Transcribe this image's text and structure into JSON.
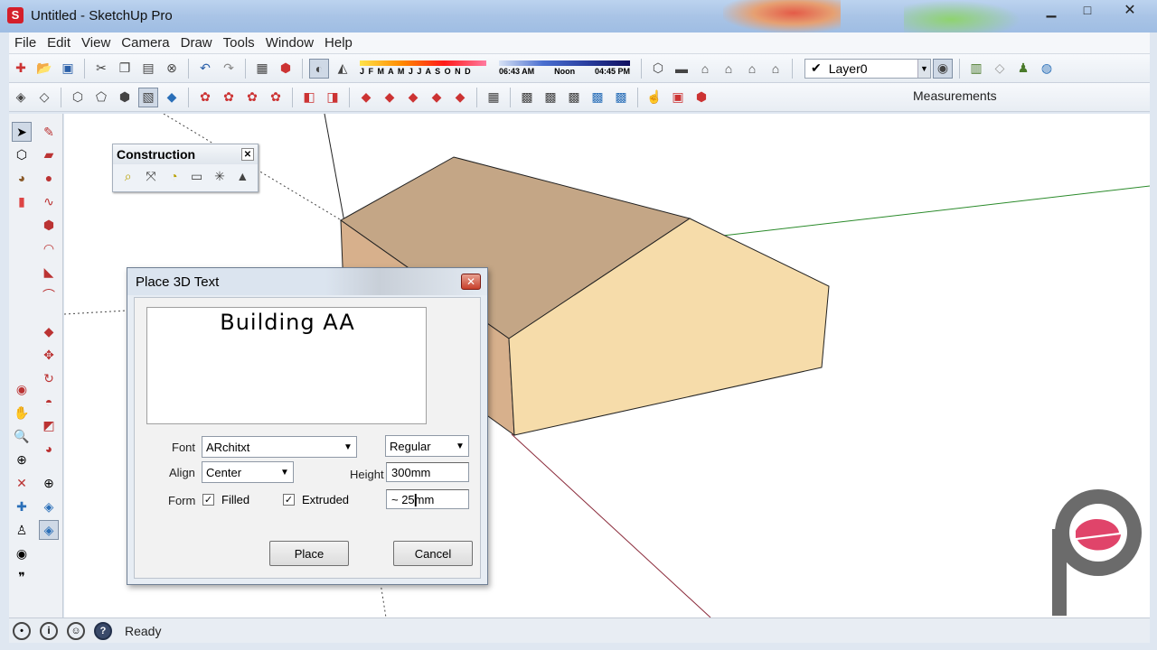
{
  "window": {
    "title": "Untitled - SketchUp Pro",
    "app_icon": "sketchup-logo-icon",
    "controls": [
      "minimize-icon",
      "maximize-icon",
      "close-icon"
    ]
  },
  "menubar": {
    "items": [
      "File",
      "Edit",
      "View",
      "Camera",
      "Draw",
      "Tools",
      "Window",
      "Help"
    ]
  },
  "toolbar1": {
    "shadow": {
      "months": "J F M A M J J A S O N D",
      "time_start": "06:43 AM",
      "time_noon": "Noon",
      "time_end": "04:45 PM"
    },
    "layer": {
      "check": "✔",
      "value": "Layer0"
    }
  },
  "toolbar2": {
    "measurements_label": "Measurements"
  },
  "construction_palette": {
    "title": "Construction",
    "close": "✕"
  },
  "dialog": {
    "title": "Place 3D Text",
    "close": "✕",
    "text_value": "Building AA",
    "font_label": "Font",
    "font_value": "ARchitxt",
    "style_value": "Regular",
    "align_label": "Align",
    "align_value": "Center",
    "height_label": "Height",
    "height_value": "300mm",
    "form_label": "Form",
    "filled_label": "Filled",
    "filled_checked": true,
    "extruded_label": "Extruded",
    "extruded_checked": true,
    "extrude_value": "~ 25mm",
    "place_button": "Place",
    "cancel_button": "Cancel",
    "check_mark": "✓"
  },
  "statusbar": {
    "status_text": "Ready",
    "help_icon_label": "?",
    "info_icon_label": "i"
  },
  "colors": {
    "roof_face": "#c4a686",
    "front_face": "#f6dcaa",
    "side_face": "#d7b08c",
    "watermark_gray": "#6b6b6b",
    "watermark_pink": "#e0446a"
  }
}
